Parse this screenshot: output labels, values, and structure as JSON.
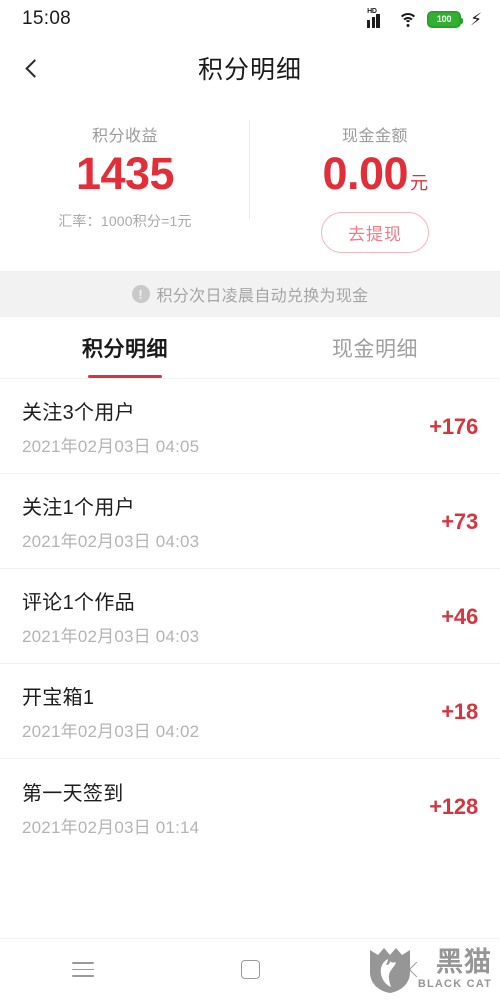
{
  "status_bar": {
    "time": "15:08",
    "hd_label": "HD",
    "battery_level": "100",
    "icons": [
      "hd-signal-icon",
      "wifi-icon",
      "battery-icon",
      "charging-bolt-icon"
    ],
    "battery_color": "#31b131"
  },
  "app_bar": {
    "back_icon": "chevron-left-icon",
    "title": "积分明细"
  },
  "summary": {
    "points": {
      "label": "积分收益",
      "value": "1435",
      "sub": "汇率：1000积分=1元"
    },
    "cash": {
      "label": "现金金额",
      "value": "0.00",
      "unit": "元",
      "withdraw_label": "去提现"
    },
    "accent_color": "#e12e39",
    "withdraw_border_color": "#f4b6bb"
  },
  "notice": {
    "icon": "exclamation-circle-icon",
    "icon_glyph": "!",
    "text": "积分次日凌晨自动兑换为现金"
  },
  "tabs": [
    {
      "label": "积分明细",
      "active": true
    },
    {
      "label": "现金明细",
      "active": false
    }
  ],
  "tab_indicator_color": "#d8343f",
  "list": [
    {
      "title": "关注3个用户",
      "date": "2021年02月03日 04:05",
      "amount": "+176"
    },
    {
      "title": "关注1个用户",
      "date": "2021年02月03日 04:03",
      "amount": "+73"
    },
    {
      "title": "评论1个作品",
      "date": "2021年02月03日 04:03",
      "amount": "+46"
    },
    {
      "title": "开宝箱1",
      "date": "2021年02月03日 04:02",
      "amount": "+18"
    },
    {
      "title": "第一天签到",
      "date": "2021年02月03日 01:14",
      "amount": "+128"
    }
  ],
  "nav_bar": {
    "items": [
      {
        "icon": "menu-icon"
      },
      {
        "icon": "home-square-icon"
      },
      {
        "icon": "back-chevron-icon"
      }
    ]
  },
  "watermark": {
    "icon": "black-cat-shield-logo",
    "cn": "黑猫",
    "en": "BLACK CAT",
    "color": "#8e8e8e"
  }
}
